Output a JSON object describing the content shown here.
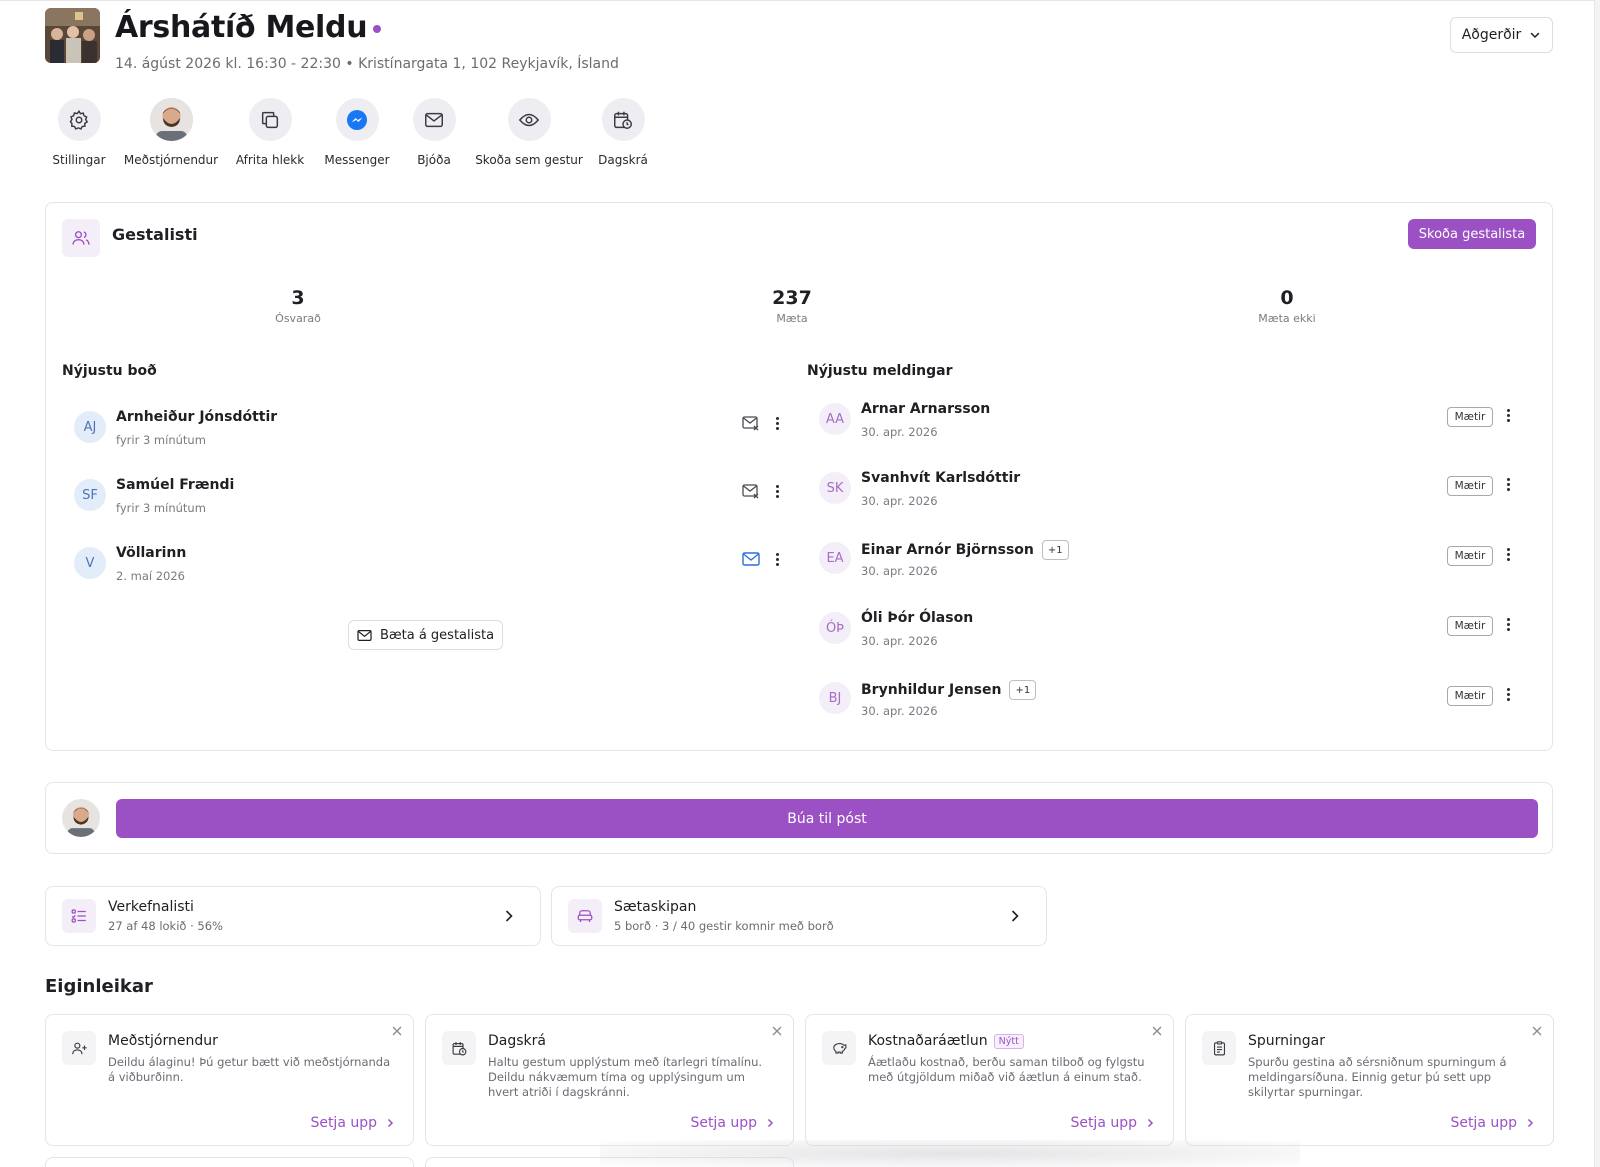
{
  "event": {
    "title": "Árshátíð Meldu",
    "subtitle": "14. ágúst 2026 kl. 16:30 - 22:30 • Kristínargata 1, 102 Reykjavík, Ísland",
    "actions_label": "Aðgerðir",
    "thumbnail_icon": "event-photo"
  },
  "quick_actions": [
    {
      "label": "Stillingar",
      "icon": "gear-icon"
    },
    {
      "label": "Meðstjórnendur",
      "icon": "cohost-avatar"
    },
    {
      "label": "Afrita hlekk",
      "icon": "copy-icon"
    },
    {
      "label": "Messenger",
      "icon": "messenger-icon"
    },
    {
      "label": "Bjóða",
      "icon": "mail-icon"
    },
    {
      "label": "Skoða sem gestur",
      "icon": "eye-icon"
    },
    {
      "label": "Dagskrá",
      "icon": "calendar-clock-icon"
    }
  ],
  "guest_list": {
    "title": "Gestalisti",
    "view_button": "Skoða gestalista",
    "stats": [
      {
        "value": "3",
        "label": "Ósvarað"
      },
      {
        "value": "237",
        "label": "Mæta"
      },
      {
        "value": "0",
        "label": "Mæta ekki"
      }
    ],
    "invites_title": "Nýjustu boð",
    "invites": [
      {
        "initials": "AJ",
        "name": "Arnheiður Jónsdóttir",
        "time": "fyrir 3 mínútum",
        "mail_state": "failed"
      },
      {
        "initials": "SF",
        "name": "Samúel Frændi",
        "time": "fyrir 3 mínútum",
        "mail_state": "failed"
      },
      {
        "initials": "V",
        "name": "Völlarinn",
        "time": "2. maí 2026",
        "mail_state": "sent"
      }
    ],
    "add_button": "Bæta á gestalista",
    "rsvps_title": "Nýjustu meldingar",
    "rsvps": [
      {
        "initials": "AA",
        "name": "Arnar Arnarsson",
        "plus": "",
        "date": "30. apr. 2026",
        "status": "Mætir"
      },
      {
        "initials": "SK",
        "name": "Svanhvít Karlsdóttir",
        "plus": "",
        "date": "30. apr. 2026",
        "status": "Mætir"
      },
      {
        "initials": "EA",
        "name": "Einar Arnór Björnsson",
        "plus": "+1",
        "date": "30. apr. 2026",
        "status": "Mætir"
      },
      {
        "initials": "ÓÞ",
        "name": "Óli Þór Ólason",
        "plus": "",
        "date": "30. apr. 2026",
        "status": "Mætir"
      },
      {
        "initials": "BJ",
        "name": "Brynhildur Jensen",
        "plus": "+1",
        "date": "30. apr. 2026",
        "status": "Mætir"
      }
    ]
  },
  "composer": {
    "button": "Búa til póst"
  },
  "links": [
    {
      "title": "Verkefnalisti",
      "sub": "27 af 48 lokið · 56%",
      "icon": "checklist-icon"
    },
    {
      "title": "Sætaskipan",
      "sub": "5 borð · 3 / 40 gestir komnir með borð",
      "icon": "seat-icon"
    }
  ],
  "features": {
    "title": "Eiginleikar",
    "items": [
      {
        "title": "Meðstjórnendur",
        "badge": "",
        "desc": "Deildu álaginu! Þú getur bætt við meðstjórnanda á viðburðinn.",
        "action": "Setja upp",
        "icon": "add-user-icon"
      },
      {
        "title": "Dagskrá",
        "badge": "",
        "desc": "Haltu gestum upplýstum með ítarlegri tímalínu. Deildu nákvæmum tíma og upplýsingum um hvert atriði í dagskránni.",
        "action": "Setja upp",
        "icon": "calendar-clock-icon"
      },
      {
        "title": "Kostnaðaráætlun",
        "badge": "Nýtt",
        "desc": "Áætlaðu kostnað, berðu saman tilboð og fylgstu með útgjöldum miðað við áætlun á einum stað.",
        "action": "Setja upp",
        "icon": "piggy-bank-icon"
      },
      {
        "title": "Spurningar",
        "badge": "",
        "desc": "Spurðu gestina að sérsniðnum spurningum á meldingarsíðuna. Einnig getur þú sett upp skilyrtar spurningar.",
        "action": "Setja upp",
        "icon": "clipboard-icon"
      }
    ]
  },
  "colors": {
    "accent": "#9b51c4",
    "accent_soft": "#f3eef7",
    "border": "#e4e4ea",
    "mail_blue": "#2f6fd8"
  }
}
